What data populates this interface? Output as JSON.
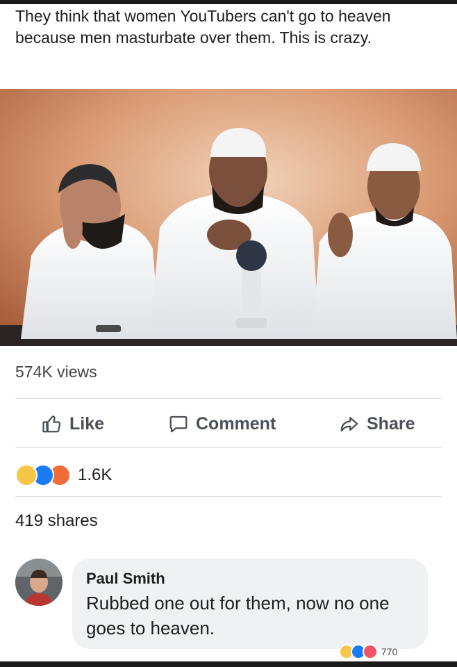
{
  "post": {
    "text": "They think that women YouTubers can't go to heaven because men masturbate over them. This is crazy."
  },
  "video": {
    "views": "574K views"
  },
  "actions": {
    "like": "Like",
    "comment": "Comment",
    "share": "Share"
  },
  "reactions": {
    "icons": [
      "haha-icon",
      "like-icon",
      "angry-icon"
    ],
    "count": "1.6K"
  },
  "shares": "419 shares",
  "comment": {
    "author": "Paul Smith",
    "text": "Rubbed one out for them, now no one goes to heaven.",
    "reaction_count": "770"
  },
  "colors": {
    "action_gray": "#4b4f56",
    "bubble": "#f0f1f3",
    "like_blue": "#1a7cf5",
    "haha_yellow": "#f7c646",
    "angry_orange": "#f06d3a"
  }
}
